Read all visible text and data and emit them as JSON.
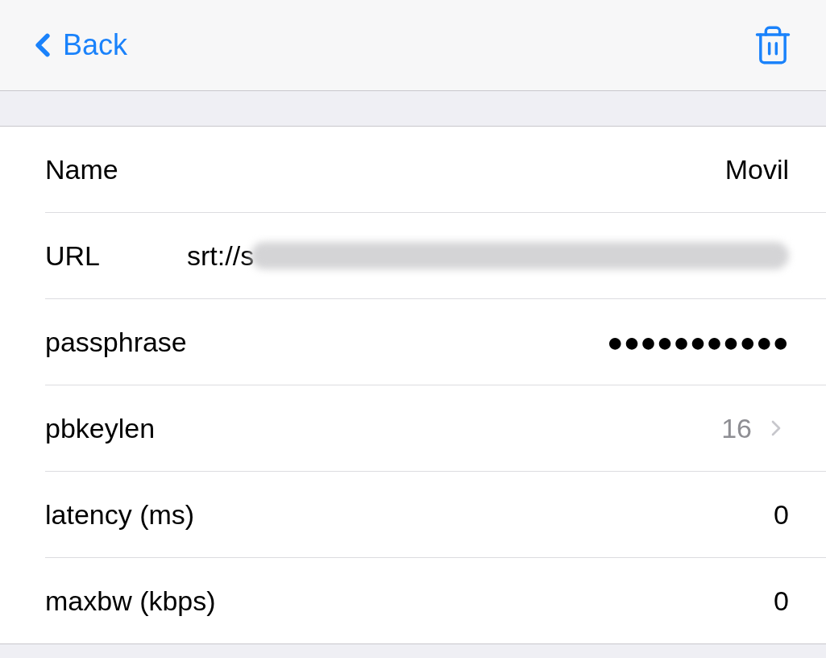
{
  "nav": {
    "back_label": "Back"
  },
  "rows": [
    {
      "kind": "value",
      "label": "Name",
      "value": "Movil"
    },
    {
      "kind": "redacted",
      "label": "URL",
      "value": "srt://s"
    },
    {
      "kind": "value",
      "label": "passphrase",
      "value": "●●●●●●●●●●●"
    },
    {
      "kind": "disclosure",
      "label": "pbkeylen",
      "value": "16"
    },
    {
      "kind": "value",
      "label": "latency (ms)",
      "value": "0"
    },
    {
      "kind": "value",
      "label": "maxbw (kbps)",
      "value": "0"
    }
  ]
}
